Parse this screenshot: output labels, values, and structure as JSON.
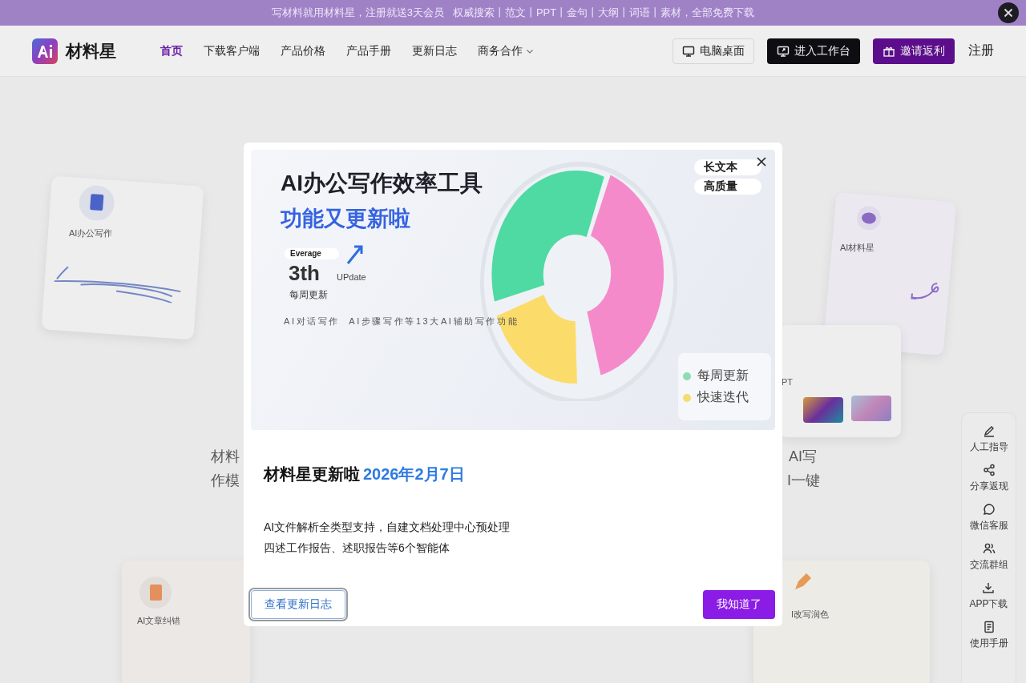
{
  "promo_bar": {
    "text": "写材料就用材料星，注册就送3天会员   权威搜索丨范文丨PPT丨金句丨大纲丨词语丨素材，全部免费下载"
  },
  "nav": {
    "logo_text": "材料星",
    "links": [
      {
        "label": "首页",
        "selected": true,
        "has_menu": false
      },
      {
        "label": "下载客户端",
        "selected": false,
        "has_menu": false
      },
      {
        "label": "产品价格",
        "selected": false,
        "has_menu": false
      },
      {
        "label": "产品手册",
        "selected": false,
        "has_menu": false
      },
      {
        "label": "更新日志",
        "selected": false,
        "has_menu": false
      },
      {
        "label": "商务合作",
        "selected": false,
        "has_menu": true
      }
    ],
    "buttons": [
      {
        "label": "电脑桌面",
        "kind": "outline"
      },
      {
        "label": "进入工作台",
        "kind": "dark"
      },
      {
        "label": "邀请返利",
        "kind": "primary"
      }
    ],
    "register": "注册"
  },
  "hero_left": [
    "材料",
    "作模"
  ],
  "hero_right": [
    "AI写",
    "I一键"
  ],
  "background_cards": [
    {
      "label": "AI办公写作",
      "kind": "office"
    },
    {
      "label": "AI材料星",
      "kind": "chat"
    },
    {
      "label": "PT",
      "kind": "ppt"
    },
    {
      "label": "AI文章纠错",
      "kind": "correct"
    },
    {
      "label": "I改写润色",
      "kind": "rewrite"
    }
  ],
  "side_rail": [
    {
      "label": "人工指导"
    },
    {
      "label": "分享返现"
    },
    {
      "label": "微信客服"
    },
    {
      "label": "交流群组"
    },
    {
      "label": "APP下载"
    },
    {
      "label": "使用手册"
    }
  ],
  "dialog": {
    "banner": {
      "headline": "AI办公写作效率工具",
      "subheadline": "功能又更新啦",
      "pill": "Everage",
      "big_number": "3th",
      "update_word": "UPdate",
      "weekly": "每周更新",
      "features": "AI对话写作  AI步骤写作等13大AI辅助写作功能",
      "tags": [
        "长文本",
        "高质量"
      ],
      "legend": [
        {
          "label": "每周更新",
          "color": "#8ddcb4"
        },
        {
          "label": "快速迭代",
          "color": "#f5dc6e"
        }
      ]
    },
    "title": "材料星更新啦",
    "date": "2026年2月7日",
    "lines": [
      "AI文件解析全类型支持，自建文档处理中心预处理",
      "四述工作报告、述职报告等6个智能体"
    ],
    "buttons": [
      {
        "label": "查看更新日志",
        "kind": "outline",
        "focused": true
      },
      {
        "label": "我知道了",
        "kind": "primary",
        "focused": false
      }
    ]
  }
}
